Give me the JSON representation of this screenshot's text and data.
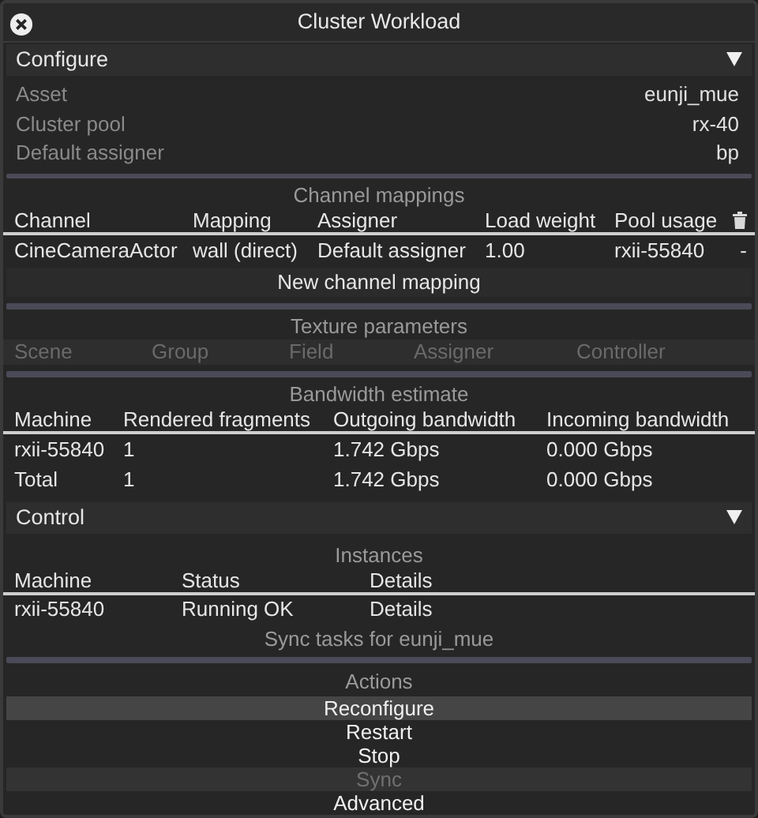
{
  "window": {
    "title": "Cluster Workload"
  },
  "configure": {
    "title": "Configure",
    "expanded": true,
    "properties": [
      {
        "label": "Asset",
        "value": "eunji_mue"
      },
      {
        "label": "Cluster pool",
        "value": "rx-40"
      },
      {
        "label": "Default assigner",
        "value": "bp"
      }
    ],
    "channel_mappings": {
      "title": "Channel mappings",
      "columns": [
        "Channel",
        "Mapping",
        "Assigner",
        "Load weight",
        "Pool usage"
      ],
      "rows": [
        {
          "cells": [
            "CineCameraActor",
            "wall (direct)",
            "Default assigner",
            "1.00",
            "rxii-55840",
            "-"
          ]
        }
      ],
      "add_button": "New channel mapping"
    },
    "texture_parameters": {
      "title": "Texture parameters",
      "columns": [
        "Scene",
        "Group",
        "Field",
        "Assigner",
        "Controller"
      ]
    },
    "bandwidth_estimate": {
      "title": "Bandwidth estimate",
      "columns": [
        "Machine",
        "Rendered fragments",
        "Outgoing bandwidth",
        "Incoming bandwidth"
      ],
      "rows": [
        [
          "rxii-55840",
          "1",
          "1.742 Gbps",
          "0.000 Gbps"
        ],
        [
          "Total",
          "1",
          "1.742 Gbps",
          "0.000 Gbps"
        ]
      ]
    }
  },
  "control": {
    "title": "Control",
    "expanded": true,
    "instances": {
      "title": "Instances",
      "columns": [
        "Machine",
        "Status",
        "Details"
      ],
      "rows": [
        [
          "rxii-55840",
          "Running OK",
          "Details"
        ]
      ]
    },
    "sync_tasks": "Sync tasks for eunji_mue",
    "actions": {
      "title": "Actions",
      "buttons": [
        {
          "label": "Reconfigure",
          "highlighted": true,
          "disabled": false
        },
        {
          "label": "Restart",
          "highlighted": false,
          "disabled": false
        },
        {
          "label": "Stop",
          "highlighted": false,
          "disabled": false
        },
        {
          "label": "Sync",
          "highlighted": false,
          "disabled": true
        },
        {
          "label": "Advanced",
          "highlighted": false,
          "disabled": false
        }
      ]
    }
  }
}
